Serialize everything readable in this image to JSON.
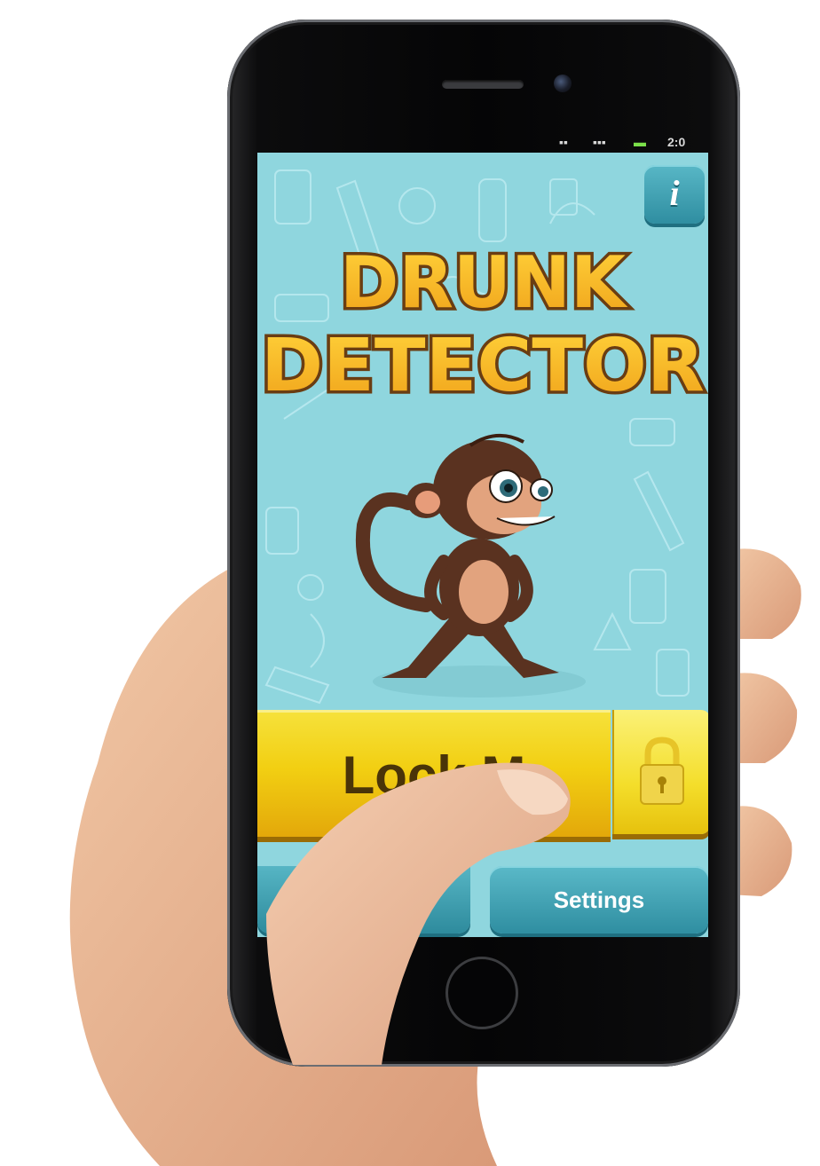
{
  "app": {
    "title_line1": "DRUNK",
    "title_line2": "DETECTOR",
    "info_icon": "info-icon",
    "info_label": "i",
    "primary_button_label": "Lock Me!",
    "primary_button_visible_text": "Lock M",
    "lock_icon": "padlock-icon",
    "settings_label": "Settings"
  },
  "status_bar": {
    "time_partial": "2:0"
  },
  "colors": {
    "screen_bg": "#8fd6de",
    "title_fill": "#f5b41b",
    "title_outline": "#6a3d12",
    "button_yellow": "#f2cf12",
    "button_teal": "#2f8ea1",
    "monkey_brown": "#5a3220"
  }
}
